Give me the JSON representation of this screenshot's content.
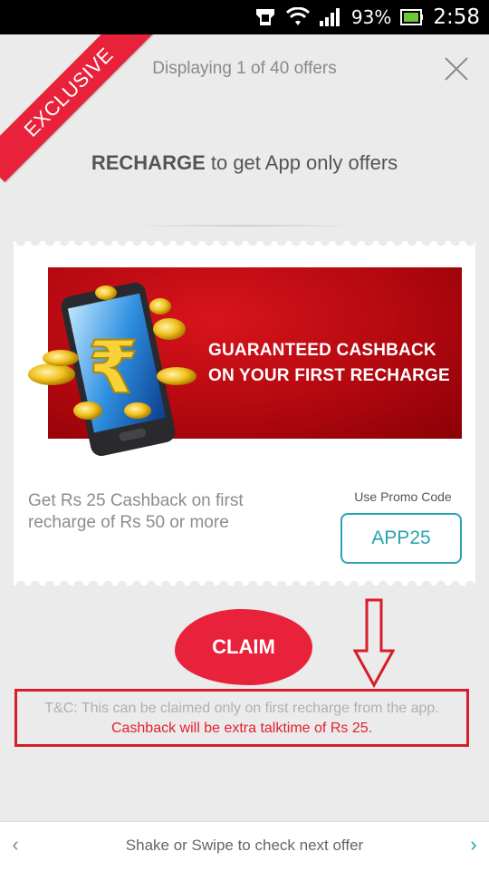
{
  "status_bar": {
    "battery_percent": "93%",
    "time": "2:58",
    "icons": [
      "notification-icon",
      "wifi-icon",
      "signal-icon",
      "battery-icon"
    ]
  },
  "header": {
    "ribbon_label": "EXCLUSIVE",
    "offers_text": "Displaying 1 of 40 offers",
    "close_icon": "close-icon"
  },
  "headline": {
    "bold": "RECHARGE",
    "rest": " to get App only offers"
  },
  "offer": {
    "banner_line1": "GUARANTEED CASHBACK",
    "banner_line2": "ON YOUR FIRST RECHARGE",
    "description": "Get Rs 25 Cashback on first recharge of Rs 50 or more",
    "promo_label": "Use Promo Code",
    "promo_code": "APP25"
  },
  "claim_label": "CLAIM",
  "tnc": {
    "line1": "T&C: This can be claimed only on first recharge from the app.",
    "line2": "Cashback will be extra talktime of Rs 25."
  },
  "bottom": {
    "hint": "Shake or Swipe to check next offer",
    "prev_icon": "chevron-left-icon",
    "next_icon": "chevron-right-icon"
  },
  "colors": {
    "accent_red": "#e8223a",
    "promo_teal": "#2aa3b3",
    "banner_red": "#b3080f"
  }
}
